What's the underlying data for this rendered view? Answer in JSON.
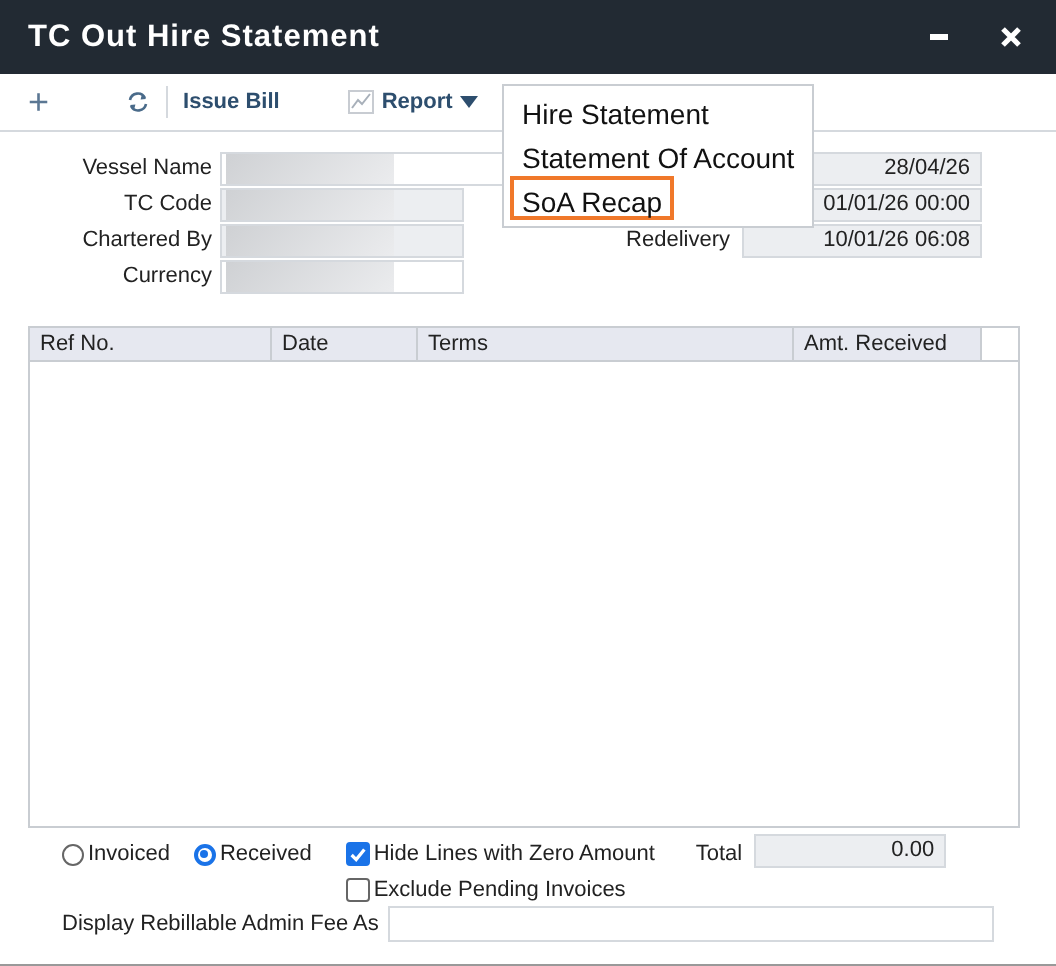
{
  "window": {
    "title": "TC Out Hire Statement"
  },
  "toolbar": {
    "add_label": "+",
    "issue_bill": "Issue Bill",
    "report": "Report"
  },
  "report_menu": [
    {
      "label": "Hire Statement",
      "selected": false
    },
    {
      "label": "Statement Of Account",
      "selected": false
    },
    {
      "label": "SoA Recap",
      "selected": true
    }
  ],
  "left_fields": [
    {
      "label": "Vessel Name"
    },
    {
      "label": "TC Code"
    },
    {
      "label": "Chartered By"
    },
    {
      "label": "Currency"
    }
  ],
  "right_fields": [
    {
      "value": "28/04/26"
    },
    {
      "value": "01/01/26 00:00"
    },
    {
      "label": "Redelivery",
      "value": "10/01/26 06:08"
    }
  ],
  "table": {
    "columns": [
      "Ref No.",
      "Date",
      "Terms",
      "Amt. Received"
    ]
  },
  "radios": [
    {
      "label": "Invoiced",
      "selected": false
    },
    {
      "label": "Received",
      "selected": true
    }
  ],
  "checkboxes": [
    {
      "label": "Hide Lines with Zero Amount",
      "checked": true
    },
    {
      "label": "Exclude Pending Invoices",
      "checked": false
    }
  ],
  "total": {
    "label": "Total",
    "value": "0.00"
  },
  "admin_fee": {
    "label": "Display Rebillable Admin Fee As"
  }
}
